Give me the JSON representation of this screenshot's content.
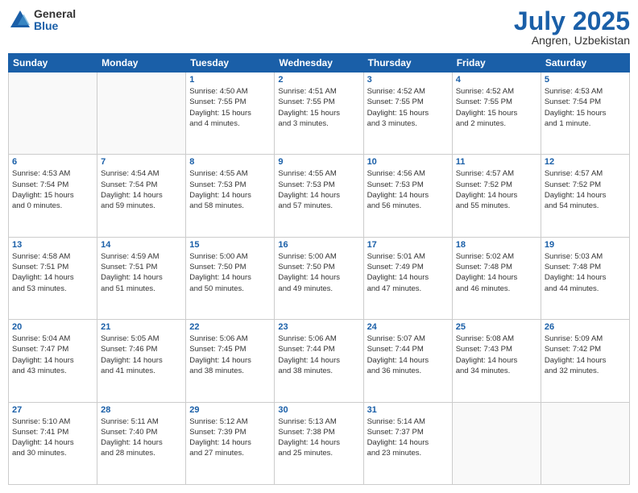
{
  "header": {
    "logo_general": "General",
    "logo_blue": "Blue",
    "month": "July 2025",
    "location": "Angren, Uzbekistan"
  },
  "weekdays": [
    "Sunday",
    "Monday",
    "Tuesday",
    "Wednesday",
    "Thursday",
    "Friday",
    "Saturday"
  ],
  "weeks": [
    [
      {
        "day": "",
        "text": ""
      },
      {
        "day": "",
        "text": ""
      },
      {
        "day": "1",
        "text": "Sunrise: 4:50 AM\nSunset: 7:55 PM\nDaylight: 15 hours\nand 4 minutes."
      },
      {
        "day": "2",
        "text": "Sunrise: 4:51 AM\nSunset: 7:55 PM\nDaylight: 15 hours\nand 3 minutes."
      },
      {
        "day": "3",
        "text": "Sunrise: 4:52 AM\nSunset: 7:55 PM\nDaylight: 15 hours\nand 3 minutes."
      },
      {
        "day": "4",
        "text": "Sunrise: 4:52 AM\nSunset: 7:55 PM\nDaylight: 15 hours\nand 2 minutes."
      },
      {
        "day": "5",
        "text": "Sunrise: 4:53 AM\nSunset: 7:54 PM\nDaylight: 15 hours\nand 1 minute."
      }
    ],
    [
      {
        "day": "6",
        "text": "Sunrise: 4:53 AM\nSunset: 7:54 PM\nDaylight: 15 hours\nand 0 minutes."
      },
      {
        "day": "7",
        "text": "Sunrise: 4:54 AM\nSunset: 7:54 PM\nDaylight: 14 hours\nand 59 minutes."
      },
      {
        "day": "8",
        "text": "Sunrise: 4:55 AM\nSunset: 7:53 PM\nDaylight: 14 hours\nand 58 minutes."
      },
      {
        "day": "9",
        "text": "Sunrise: 4:55 AM\nSunset: 7:53 PM\nDaylight: 14 hours\nand 57 minutes."
      },
      {
        "day": "10",
        "text": "Sunrise: 4:56 AM\nSunset: 7:53 PM\nDaylight: 14 hours\nand 56 minutes."
      },
      {
        "day": "11",
        "text": "Sunrise: 4:57 AM\nSunset: 7:52 PM\nDaylight: 14 hours\nand 55 minutes."
      },
      {
        "day": "12",
        "text": "Sunrise: 4:57 AM\nSunset: 7:52 PM\nDaylight: 14 hours\nand 54 minutes."
      }
    ],
    [
      {
        "day": "13",
        "text": "Sunrise: 4:58 AM\nSunset: 7:51 PM\nDaylight: 14 hours\nand 53 minutes."
      },
      {
        "day": "14",
        "text": "Sunrise: 4:59 AM\nSunset: 7:51 PM\nDaylight: 14 hours\nand 51 minutes."
      },
      {
        "day": "15",
        "text": "Sunrise: 5:00 AM\nSunset: 7:50 PM\nDaylight: 14 hours\nand 50 minutes."
      },
      {
        "day": "16",
        "text": "Sunrise: 5:00 AM\nSunset: 7:50 PM\nDaylight: 14 hours\nand 49 minutes."
      },
      {
        "day": "17",
        "text": "Sunrise: 5:01 AM\nSunset: 7:49 PM\nDaylight: 14 hours\nand 47 minutes."
      },
      {
        "day": "18",
        "text": "Sunrise: 5:02 AM\nSunset: 7:48 PM\nDaylight: 14 hours\nand 46 minutes."
      },
      {
        "day": "19",
        "text": "Sunrise: 5:03 AM\nSunset: 7:48 PM\nDaylight: 14 hours\nand 44 minutes."
      }
    ],
    [
      {
        "day": "20",
        "text": "Sunrise: 5:04 AM\nSunset: 7:47 PM\nDaylight: 14 hours\nand 43 minutes."
      },
      {
        "day": "21",
        "text": "Sunrise: 5:05 AM\nSunset: 7:46 PM\nDaylight: 14 hours\nand 41 minutes."
      },
      {
        "day": "22",
        "text": "Sunrise: 5:06 AM\nSunset: 7:45 PM\nDaylight: 14 hours\nand 38 minutes."
      },
      {
        "day": "23",
        "text": "Sunrise: 5:06 AM\nSunset: 7:44 PM\nDaylight: 14 hours\nand 38 minutes."
      },
      {
        "day": "24",
        "text": "Sunrise: 5:07 AM\nSunset: 7:44 PM\nDaylight: 14 hours\nand 36 minutes."
      },
      {
        "day": "25",
        "text": "Sunrise: 5:08 AM\nSunset: 7:43 PM\nDaylight: 14 hours\nand 34 minutes."
      },
      {
        "day": "26",
        "text": "Sunrise: 5:09 AM\nSunset: 7:42 PM\nDaylight: 14 hours\nand 32 minutes."
      }
    ],
    [
      {
        "day": "27",
        "text": "Sunrise: 5:10 AM\nSunset: 7:41 PM\nDaylight: 14 hours\nand 30 minutes."
      },
      {
        "day": "28",
        "text": "Sunrise: 5:11 AM\nSunset: 7:40 PM\nDaylight: 14 hours\nand 28 minutes."
      },
      {
        "day": "29",
        "text": "Sunrise: 5:12 AM\nSunset: 7:39 PM\nDaylight: 14 hours\nand 27 minutes."
      },
      {
        "day": "30",
        "text": "Sunrise: 5:13 AM\nSunset: 7:38 PM\nDaylight: 14 hours\nand 25 minutes."
      },
      {
        "day": "31",
        "text": "Sunrise: 5:14 AM\nSunset: 7:37 PM\nDaylight: 14 hours\nand 23 minutes."
      },
      {
        "day": "",
        "text": ""
      },
      {
        "day": "",
        "text": ""
      }
    ]
  ]
}
